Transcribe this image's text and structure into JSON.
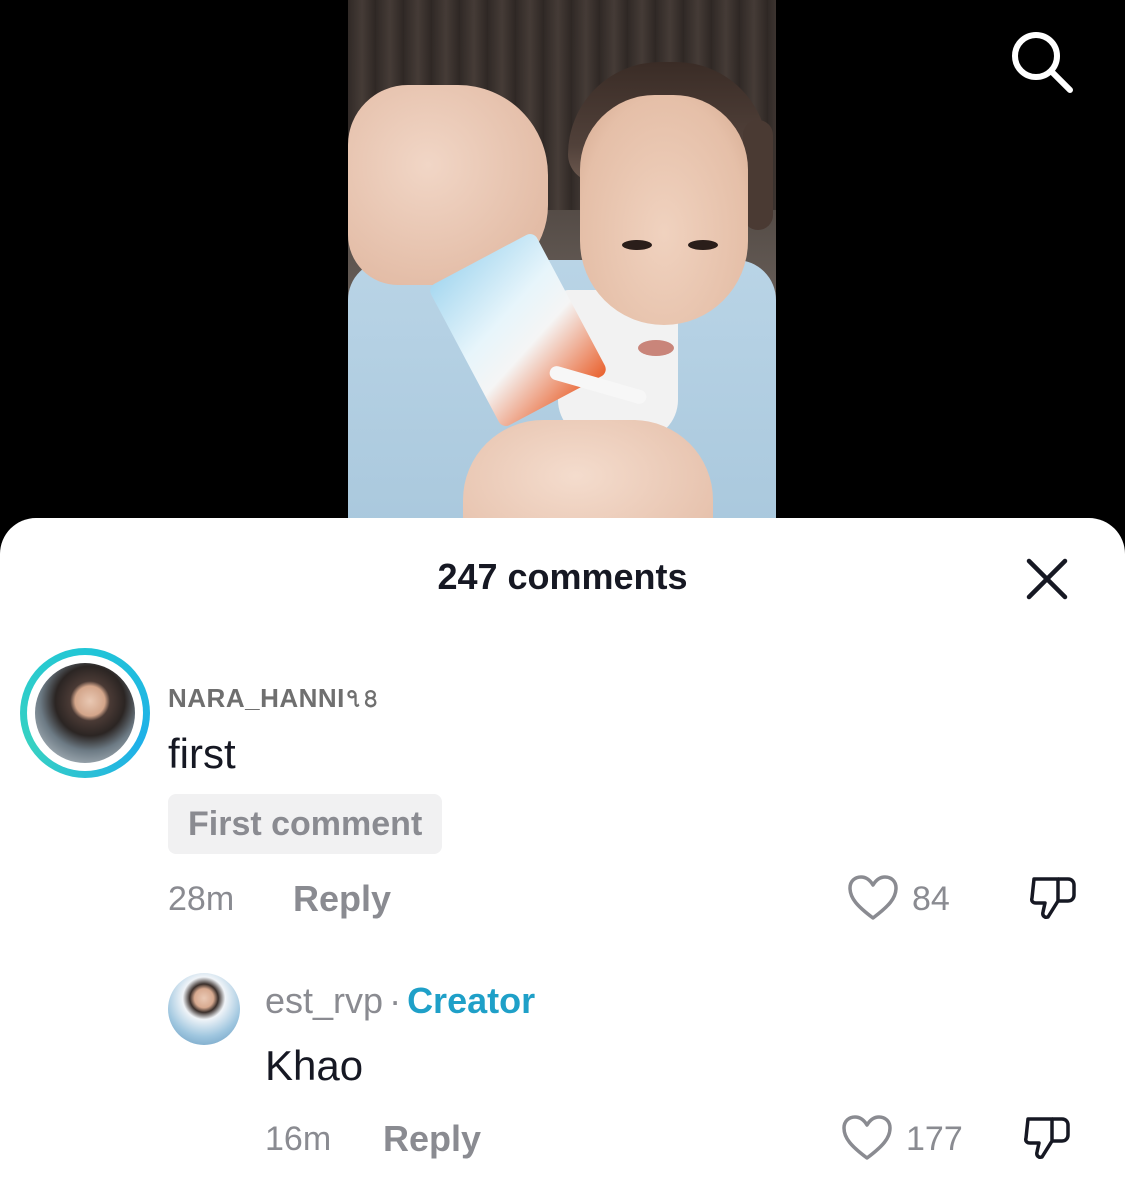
{
  "sheet": {
    "title": "247 comments"
  },
  "comments": [
    {
      "username": "NARA_HANNI৭৪",
      "text": "first",
      "badge": "First comment",
      "time": "28m",
      "reply_label": "Reply",
      "likes": "84"
    }
  ],
  "replies": [
    {
      "username": "est_rvp",
      "separator": "·",
      "role": "Creator",
      "text": "Khao",
      "time": "16m",
      "reply_label": "Reply",
      "likes": "177"
    }
  ],
  "icons": {
    "search": "search-icon",
    "close": "close-icon",
    "like": "heart-icon",
    "dislike": "thumbs-down-icon"
  },
  "colors": {
    "accent_creator": "#1fa0c8",
    "ring": "#21c6d6",
    "muted": "#8a8b91",
    "text": "#161823"
  }
}
